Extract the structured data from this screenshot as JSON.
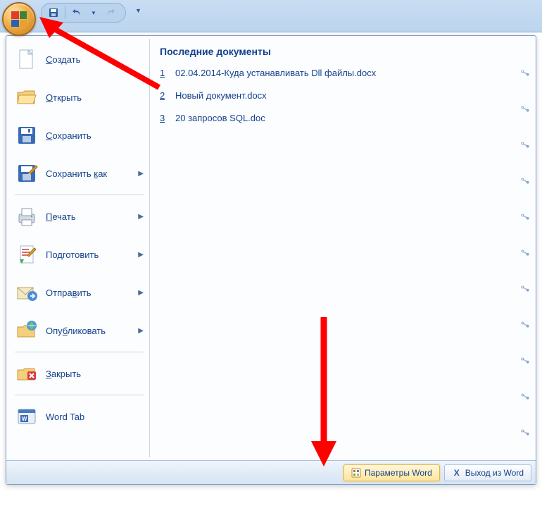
{
  "qat": {
    "save_tip": "Сохранить",
    "undo_tip": "Отменить",
    "redo_tip": "Вернуть"
  },
  "menu": {
    "items": [
      {
        "label": "Создать",
        "u": "С",
        "rest": "оздать",
        "arrow": false
      },
      {
        "label": "Открыть",
        "u": "О",
        "rest": "ткрыть",
        "arrow": false
      },
      {
        "label": "Сохранить",
        "u": "С",
        "rest": "охранить",
        "arrow": false
      },
      {
        "label": "Сохранить как",
        "u": "к",
        "pre": "Сохранить ",
        "rest": "ак",
        "arrow": true
      },
      {
        "label": "Печать",
        "u": "П",
        "rest": "ечать",
        "arrow": true
      },
      {
        "label": "Подготовить",
        "u": "д",
        "pre": "По",
        "rest": "готовить",
        "arrow": true
      },
      {
        "label": "Отправить",
        "u": "в",
        "pre": "Отпра",
        "rest": "ить",
        "arrow": true
      },
      {
        "label": "Опубликовать",
        "u": "б",
        "pre": "Опу",
        "rest": "ликовать",
        "arrow": true
      },
      {
        "label": "Закрыть",
        "u": "З",
        "rest": "акрыть",
        "arrow": false
      },
      {
        "label": "Word Tab",
        "u": "",
        "rest": "Word Tab",
        "arrow": false
      }
    ]
  },
  "recent": {
    "title": "Последние документы",
    "items": [
      {
        "num": "1",
        "name": "02.04.2014-Куда устанавливать Dll файлы.docx"
      },
      {
        "num": "2",
        "name": "Новый документ.docx"
      },
      {
        "num": "3",
        "name": "20 запросов SQL.doc"
      }
    ]
  },
  "footer": {
    "options": "Параметры Word",
    "exit": "Выход из Word"
  }
}
